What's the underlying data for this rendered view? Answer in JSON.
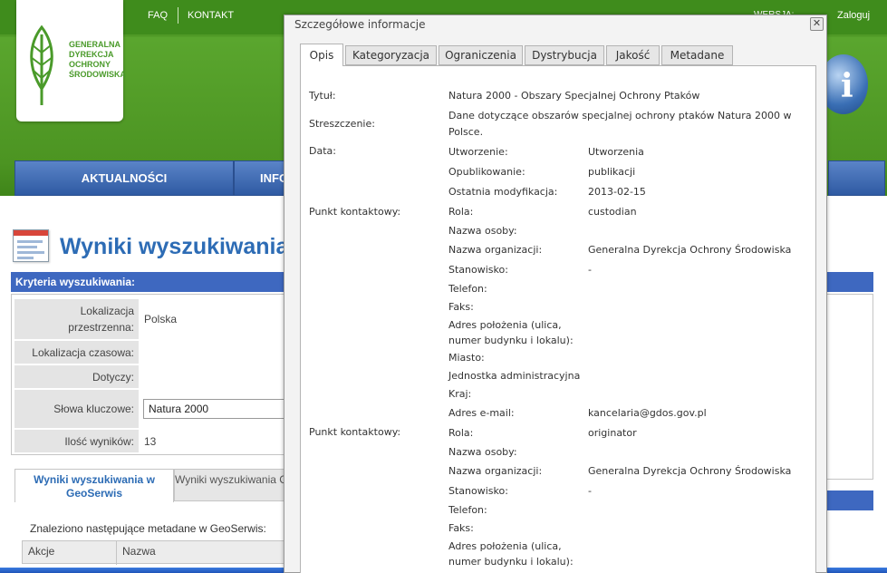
{
  "header": {
    "logo_lines": [
      "GENERALNA",
      "DYREKCJA",
      "OCHRONY",
      "ŚRODOWISKA"
    ],
    "links": {
      "faq": "FAQ",
      "contact": "KONTAKT",
      "version": "WERSJA:",
      "login": "Zaloguj"
    },
    "nav": [
      {
        "label": "AKTUALNOŚCI"
      },
      {
        "label": "INFO"
      }
    ]
  },
  "page": {
    "title": "Wyniki wyszukiwania",
    "criteria_header": "Kryteria wyszukiwania:",
    "criteria": [
      {
        "label": "Lokalizacja przestrzenna:",
        "value": "Polska"
      },
      {
        "label": "Lokalizacja czasowa:",
        "value": ""
      },
      {
        "label": "Dotyczy:",
        "value": ""
      },
      {
        "label": "Słowa kluczowe:",
        "value": "Natura 2000"
      },
      {
        "label": "Ilość wyników:",
        "value": "13"
      }
    ],
    "result_tabs": [
      {
        "label": "Wyniki wyszukiwania w GeoSerwis"
      },
      {
        "label": "Wyniki wyszukiwania CIOŚ"
      }
    ],
    "found_text": "Znaleziono następujące metadane w GeoSerwis:",
    "table_headers": [
      "Akcje",
      "Nazwa"
    ]
  },
  "dialog": {
    "title": "Szczegółowe informacje",
    "close_glyph": "✕",
    "tabs": [
      "Opis",
      "Kategoryzacja",
      "Ograniczenia",
      "Dystrybucja",
      "Jakość",
      "Metadane"
    ],
    "fields": {
      "title_label": "Tytuł:",
      "title_value": "Natura 2000 - Obszary Specjalnej Ochrony Ptaków",
      "abstract_label": "Streszczenie:",
      "abstract_value": "Dane dotyczące obszarów specjalnej ochrony ptaków Natura 2000 w Polsce.",
      "date_label": "Data:",
      "dates": [
        {
          "label": "Utworzenie:",
          "value": "Utworzenia"
        },
        {
          "label": "Opublikowanie:",
          "value": "publikacji"
        },
        {
          "label": "Ostatnia modyfikacja:",
          "value": "2013-02-15"
        }
      ],
      "contact_label": "Punkt kontaktowy:",
      "contacts": [
        [
          {
            "label": "Rola:",
            "value": "custodian"
          },
          {
            "label": "Nazwa osoby:",
            "value": ""
          },
          {
            "label": "Nazwa organizacji:",
            "value": "Generalna Dyrekcja Ochrony Środowiska"
          },
          {
            "label": "Stanowisko:",
            "value": "-"
          },
          {
            "label": "Telefon:",
            "value": ""
          },
          {
            "label": "Faks:",
            "value": ""
          },
          {
            "label": "Adres położenia (ulica, numer budynku i lokalu):",
            "value": ""
          },
          {
            "label": "Miasto:",
            "value": ""
          },
          {
            "label": "Jednostka administracyjna",
            "value": ""
          },
          {
            "label": "Kraj:",
            "value": ""
          },
          {
            "label": "Adres e-mail:",
            "value": "kancelaria@gdos.gov.pl"
          }
        ],
        [
          {
            "label": "Rola:",
            "value": "originator"
          },
          {
            "label": "Nazwa osoby:",
            "value": ""
          },
          {
            "label": "Nazwa organizacji:",
            "value": "Generalna Dyrekcja Ochrony Środowiska"
          },
          {
            "label": "Stanowisko:",
            "value": "-"
          },
          {
            "label": "Telefon:",
            "value": ""
          },
          {
            "label": "Faks:",
            "value": ""
          },
          {
            "label": "Adres położenia (ulica, numer budynku i lokalu):",
            "value": ""
          }
        ]
      ]
    }
  }
}
